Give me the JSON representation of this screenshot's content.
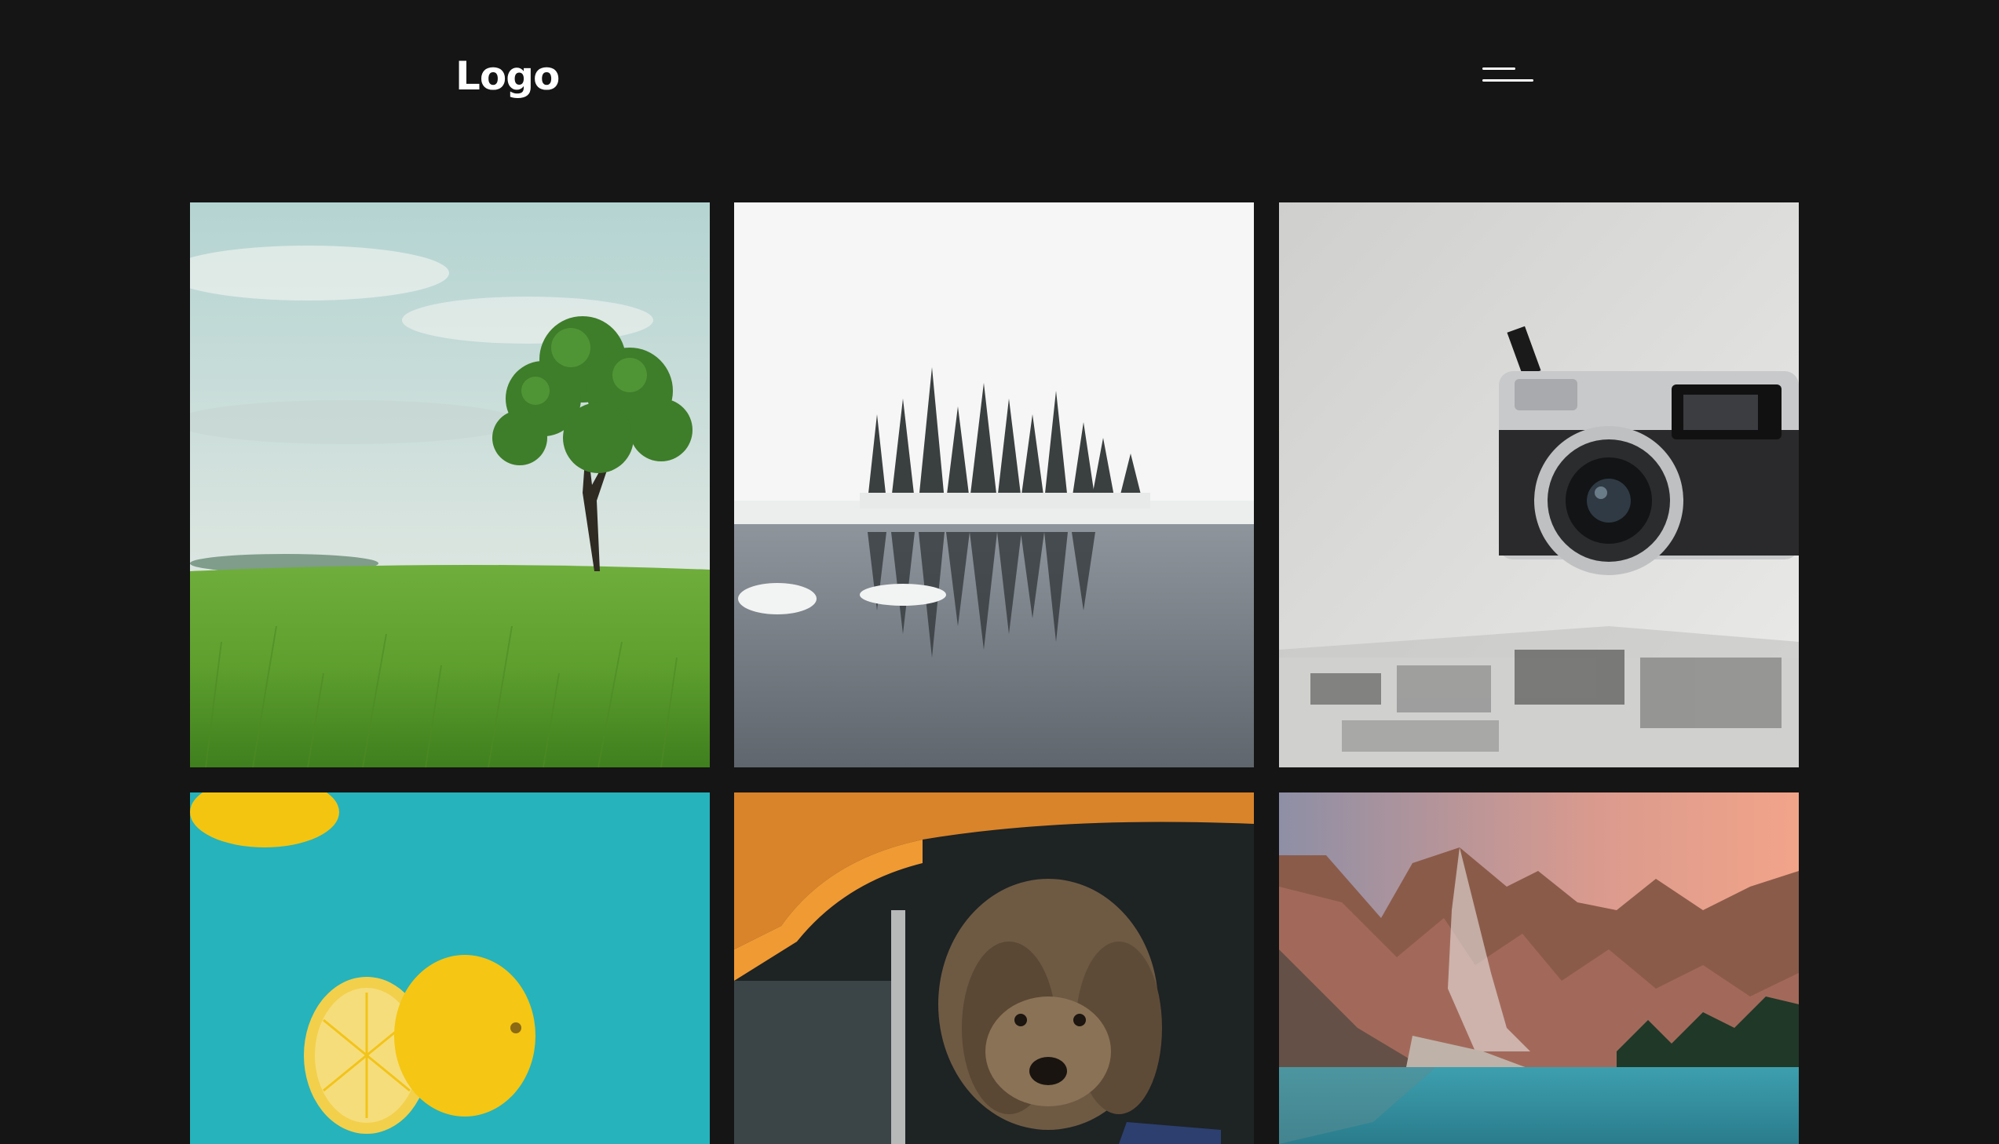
{
  "header": {
    "logo_text": "Logo",
    "menu_icon": "hamburger-menu-icon"
  },
  "gallery": {
    "items": [
      {
        "subject": "tree-in-field"
      },
      {
        "subject": "snowy-island-lake"
      },
      {
        "subject": "camera"
      },
      {
        "subject": "lemons"
      },
      {
        "subject": "dog-in-car"
      },
      {
        "subject": "mountain-lake"
      }
    ]
  },
  "colors": {
    "background": "#151515",
    "text": "#ffffff"
  }
}
